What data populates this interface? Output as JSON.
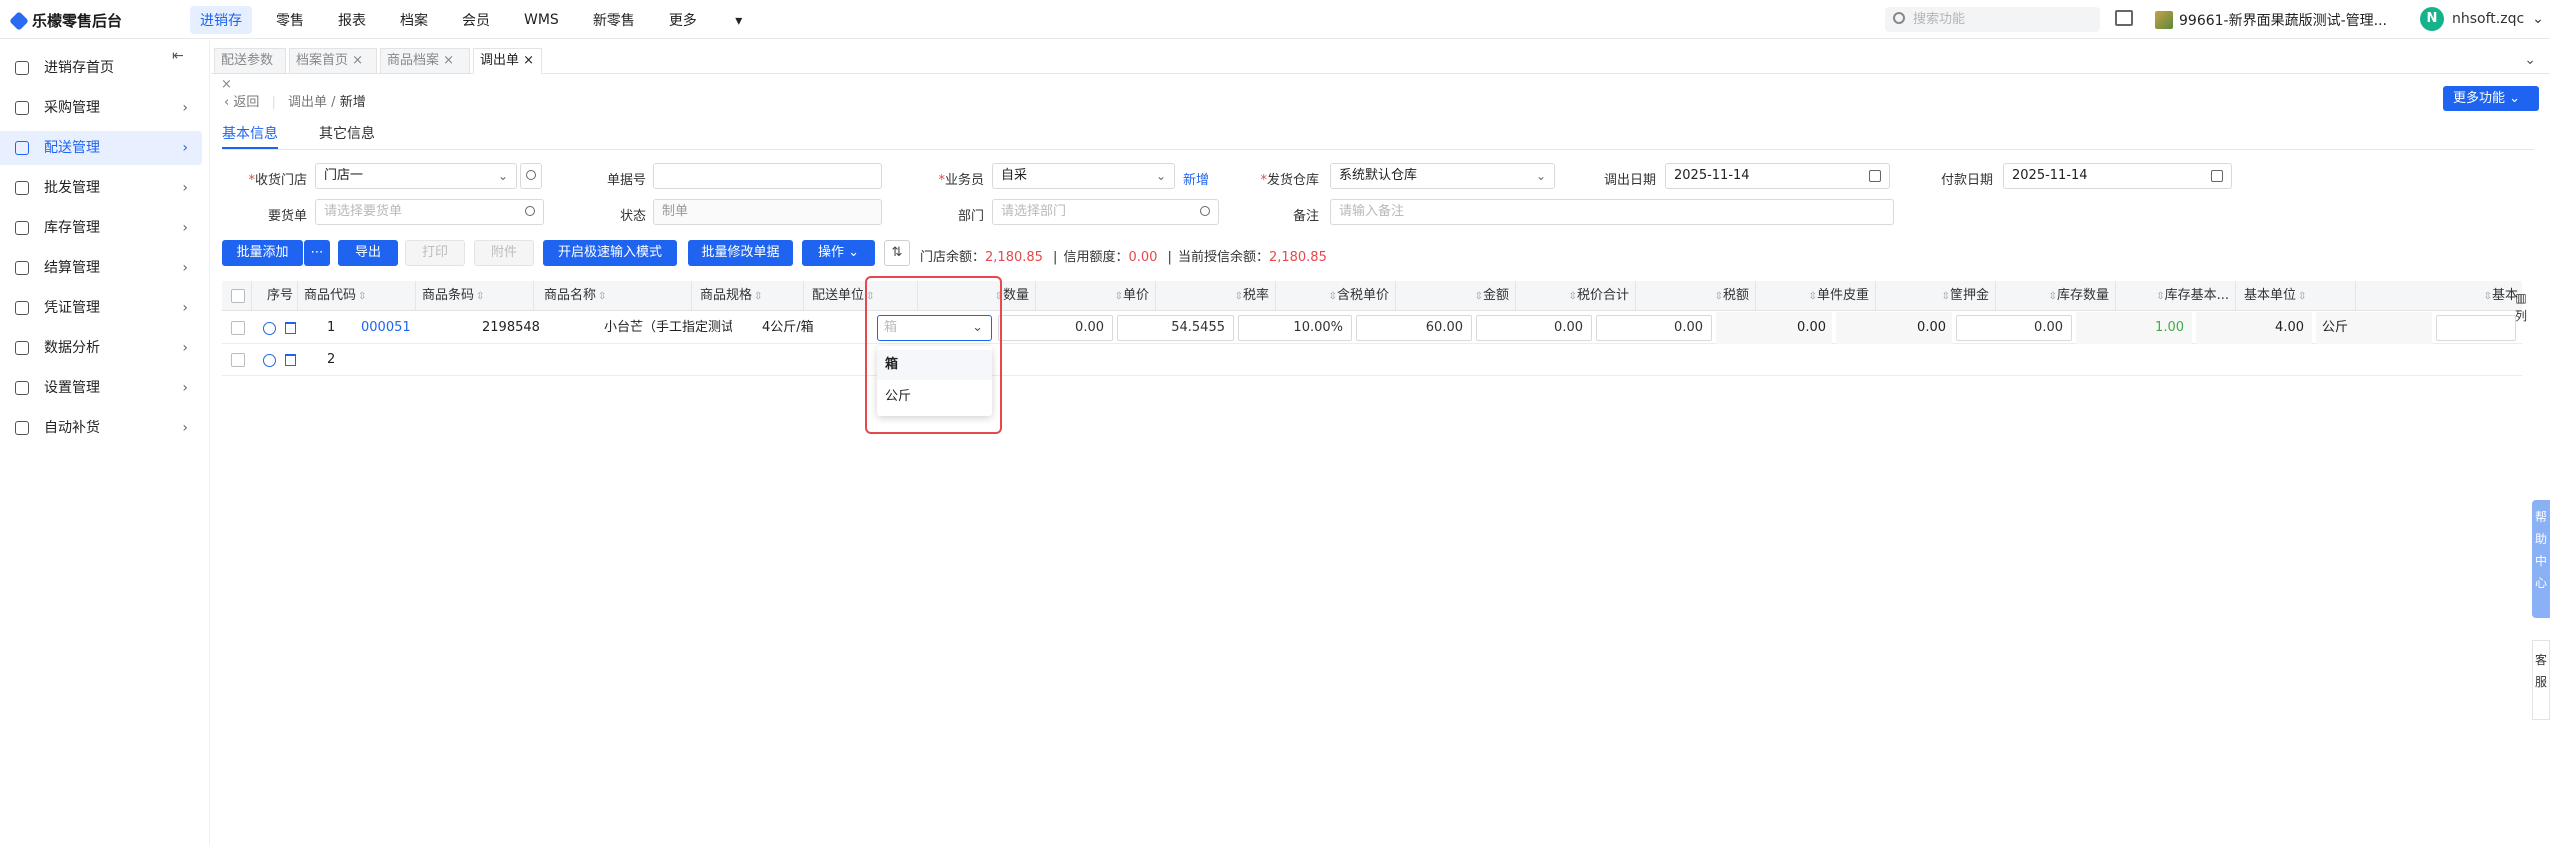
{
  "app": {
    "name": "乐檬零售后台"
  },
  "topnav": [
    "进销存",
    "零售",
    "报表",
    "档案",
    "会员",
    "WMS",
    "新零售",
    "更多"
  ],
  "search": {
    "placeholder": "搜索功能"
  },
  "store": {
    "name": "99661-新界面果蔬版测试-管理..."
  },
  "user": {
    "initial": "N",
    "name": "nhsoft.zqc"
  },
  "sidebar": {
    "items": [
      {
        "label": "进销存首页"
      },
      {
        "label": "采购管理"
      },
      {
        "label": "配送管理",
        "active": true
      },
      {
        "label": "批发管理"
      },
      {
        "label": "库存管理"
      },
      {
        "label": "结算管理"
      },
      {
        "label": "凭证管理"
      },
      {
        "label": "数据分析"
      },
      {
        "label": "设置管理"
      },
      {
        "label": "自动补货"
      }
    ]
  },
  "tabs": [
    "配送参数",
    "档案首页",
    "商品档案",
    "调出单"
  ],
  "breadcrumb": {
    "back": "返回",
    "parent": "调出单",
    "current": "新增"
  },
  "more_functions": "更多功能",
  "subtabs": [
    "基本信息",
    "其它信息"
  ],
  "form": {
    "recv_store": {
      "label": "收货门店",
      "value": "门店一"
    },
    "order_no": {
      "label": "单据号",
      "value": ""
    },
    "salesman": {
      "label": "业务员",
      "value": "自采",
      "new_link": "新增"
    },
    "ship_warehouse": {
      "label": "发货仓库",
      "value": "系统默认仓库"
    },
    "out_date": {
      "label": "调出日期",
      "value": "2025-11-14"
    },
    "pay_date": {
      "label": "付款日期",
      "value": "2025-11-14"
    },
    "req_order": {
      "label": "要货单",
      "placeholder": "请选择要货单"
    },
    "status": {
      "label": "状态",
      "value": "制单"
    },
    "dept": {
      "label": "部门",
      "placeholder": "请选择部门"
    },
    "remark": {
      "label": "备注",
      "placeholder": "请输入备注"
    }
  },
  "toolbar": {
    "batch_add": "批量添加",
    "export": "导出",
    "print": "打印",
    "attach": "附件",
    "fast_input": "开启极速输入模式",
    "batch_edit": "批量修改单据",
    "operate": "操作"
  },
  "balance": {
    "store_label": "门店余额：",
    "store_value": "2,180.85",
    "credit_label": "信用额度：",
    "credit_value": "0.00",
    "trust_label": "当前授信余额：",
    "trust_value": "2,180.85"
  },
  "table": {
    "headers": [
      "序号",
      "商品代码",
      "商品条码",
      "商品名称",
      "商品规格",
      "配送单位",
      "数量",
      "单价",
      "税率",
      "含税单价",
      "金额",
      "税价合计",
      "税额",
      "单件皮重",
      "筐押金",
      "库存数量",
      "库存基本...",
      "基本单位",
      "基本"
    ],
    "rows": [
      {
        "seq": "1",
        "code": "000051",
        "barcode": "2198548",
        "name": "小台芒（手工指定测试",
        "spec": "4公斤/箱",
        "unit": "箱",
        "qty": "0.00",
        "price": "54.5455",
        "tax_rate": "10.00%",
        "tax_price": "60.00",
        "amount": "0.00",
        "total": "0.00",
        "tax": "0.00",
        "tare": "0.00",
        "deposit": "0.00",
        "stock": "1.00",
        "stock_base": "4.00",
        "base_unit": "公斤"
      },
      {
        "seq": "2"
      }
    ]
  },
  "unit_dropdown": [
    "箱",
    "公斤"
  ],
  "side_tools": {
    "columns": "列",
    "help": "帮助中心",
    "service": "客服"
  }
}
